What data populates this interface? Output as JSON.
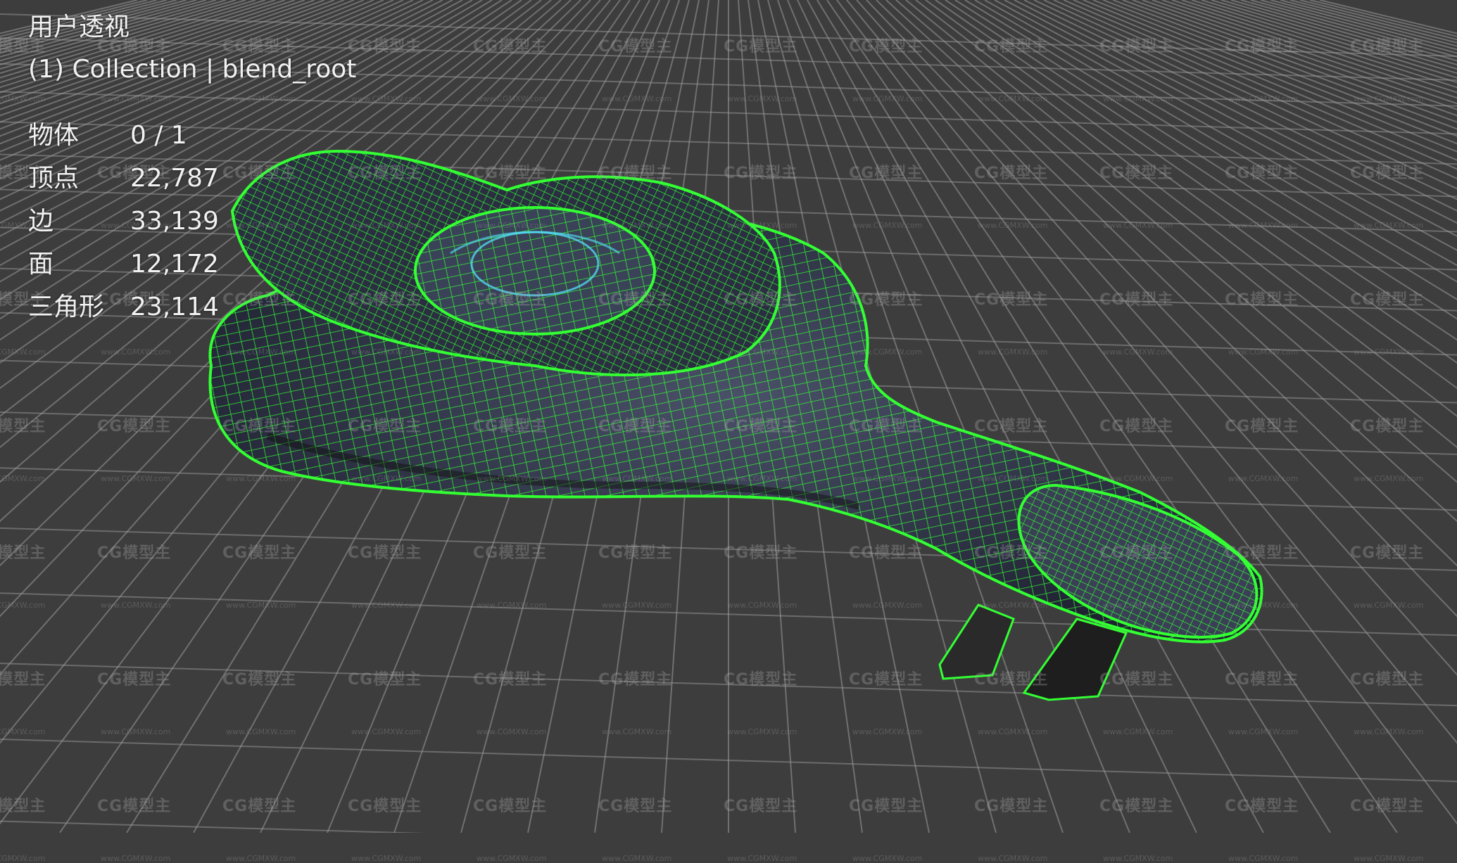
{
  "viewport": {
    "view_name": "用户透视",
    "collection_label": "(1) Collection | blend_root",
    "stats": [
      {
        "label": "物体",
        "value": "0 / 1"
      },
      {
        "label": "顶点",
        "value": "22,787"
      },
      {
        "label": "边",
        "value": "33,139"
      },
      {
        "label": "面",
        "value": "12,172"
      },
      {
        "label": "三角形",
        "value": "23,114"
      }
    ]
  },
  "watermark": {
    "logo_text": "CG模型主",
    "url_text": "www.CGMXW.com"
  },
  "colors": {
    "background": "#3d3d3d",
    "grid_line": "#9a9a9a",
    "wireframe": "#33ff33",
    "model_body": "#2e3245",
    "model_highlight": "#55e8ff"
  }
}
